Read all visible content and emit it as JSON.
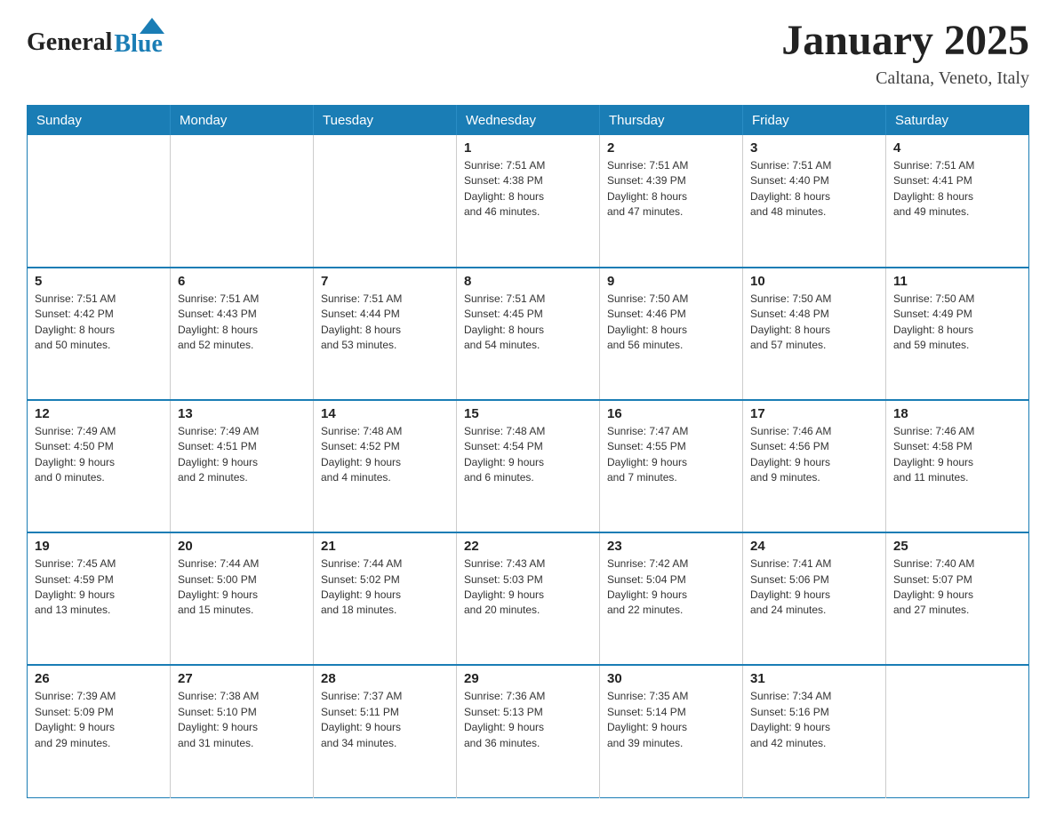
{
  "header": {
    "logo_general": "General",
    "logo_blue": "Blue",
    "month_title": "January 2025",
    "location": "Caltana, Veneto, Italy"
  },
  "weekdays": [
    "Sunday",
    "Monday",
    "Tuesday",
    "Wednesday",
    "Thursday",
    "Friday",
    "Saturday"
  ],
  "weeks": [
    [
      {
        "day": "",
        "info": ""
      },
      {
        "day": "",
        "info": ""
      },
      {
        "day": "",
        "info": ""
      },
      {
        "day": "1",
        "info": "Sunrise: 7:51 AM\nSunset: 4:38 PM\nDaylight: 8 hours\nand 46 minutes."
      },
      {
        "day": "2",
        "info": "Sunrise: 7:51 AM\nSunset: 4:39 PM\nDaylight: 8 hours\nand 47 minutes."
      },
      {
        "day": "3",
        "info": "Sunrise: 7:51 AM\nSunset: 4:40 PM\nDaylight: 8 hours\nand 48 minutes."
      },
      {
        "day": "4",
        "info": "Sunrise: 7:51 AM\nSunset: 4:41 PM\nDaylight: 8 hours\nand 49 minutes."
      }
    ],
    [
      {
        "day": "5",
        "info": "Sunrise: 7:51 AM\nSunset: 4:42 PM\nDaylight: 8 hours\nand 50 minutes."
      },
      {
        "day": "6",
        "info": "Sunrise: 7:51 AM\nSunset: 4:43 PM\nDaylight: 8 hours\nand 52 minutes."
      },
      {
        "day": "7",
        "info": "Sunrise: 7:51 AM\nSunset: 4:44 PM\nDaylight: 8 hours\nand 53 minutes."
      },
      {
        "day": "8",
        "info": "Sunrise: 7:51 AM\nSunset: 4:45 PM\nDaylight: 8 hours\nand 54 minutes."
      },
      {
        "day": "9",
        "info": "Sunrise: 7:50 AM\nSunset: 4:46 PM\nDaylight: 8 hours\nand 56 minutes."
      },
      {
        "day": "10",
        "info": "Sunrise: 7:50 AM\nSunset: 4:48 PM\nDaylight: 8 hours\nand 57 minutes."
      },
      {
        "day": "11",
        "info": "Sunrise: 7:50 AM\nSunset: 4:49 PM\nDaylight: 8 hours\nand 59 minutes."
      }
    ],
    [
      {
        "day": "12",
        "info": "Sunrise: 7:49 AM\nSunset: 4:50 PM\nDaylight: 9 hours\nand 0 minutes."
      },
      {
        "day": "13",
        "info": "Sunrise: 7:49 AM\nSunset: 4:51 PM\nDaylight: 9 hours\nand 2 minutes."
      },
      {
        "day": "14",
        "info": "Sunrise: 7:48 AM\nSunset: 4:52 PM\nDaylight: 9 hours\nand 4 minutes."
      },
      {
        "day": "15",
        "info": "Sunrise: 7:48 AM\nSunset: 4:54 PM\nDaylight: 9 hours\nand 6 minutes."
      },
      {
        "day": "16",
        "info": "Sunrise: 7:47 AM\nSunset: 4:55 PM\nDaylight: 9 hours\nand 7 minutes."
      },
      {
        "day": "17",
        "info": "Sunrise: 7:46 AM\nSunset: 4:56 PM\nDaylight: 9 hours\nand 9 minutes."
      },
      {
        "day": "18",
        "info": "Sunrise: 7:46 AM\nSunset: 4:58 PM\nDaylight: 9 hours\nand 11 minutes."
      }
    ],
    [
      {
        "day": "19",
        "info": "Sunrise: 7:45 AM\nSunset: 4:59 PM\nDaylight: 9 hours\nand 13 minutes."
      },
      {
        "day": "20",
        "info": "Sunrise: 7:44 AM\nSunset: 5:00 PM\nDaylight: 9 hours\nand 15 minutes."
      },
      {
        "day": "21",
        "info": "Sunrise: 7:44 AM\nSunset: 5:02 PM\nDaylight: 9 hours\nand 18 minutes."
      },
      {
        "day": "22",
        "info": "Sunrise: 7:43 AM\nSunset: 5:03 PM\nDaylight: 9 hours\nand 20 minutes."
      },
      {
        "day": "23",
        "info": "Sunrise: 7:42 AM\nSunset: 5:04 PM\nDaylight: 9 hours\nand 22 minutes."
      },
      {
        "day": "24",
        "info": "Sunrise: 7:41 AM\nSunset: 5:06 PM\nDaylight: 9 hours\nand 24 minutes."
      },
      {
        "day": "25",
        "info": "Sunrise: 7:40 AM\nSunset: 5:07 PM\nDaylight: 9 hours\nand 27 minutes."
      }
    ],
    [
      {
        "day": "26",
        "info": "Sunrise: 7:39 AM\nSunset: 5:09 PM\nDaylight: 9 hours\nand 29 minutes."
      },
      {
        "day": "27",
        "info": "Sunrise: 7:38 AM\nSunset: 5:10 PM\nDaylight: 9 hours\nand 31 minutes."
      },
      {
        "day": "28",
        "info": "Sunrise: 7:37 AM\nSunset: 5:11 PM\nDaylight: 9 hours\nand 34 minutes."
      },
      {
        "day": "29",
        "info": "Sunrise: 7:36 AM\nSunset: 5:13 PM\nDaylight: 9 hours\nand 36 minutes."
      },
      {
        "day": "30",
        "info": "Sunrise: 7:35 AM\nSunset: 5:14 PM\nDaylight: 9 hours\nand 39 minutes."
      },
      {
        "day": "31",
        "info": "Sunrise: 7:34 AM\nSunset: 5:16 PM\nDaylight: 9 hours\nand 42 minutes."
      },
      {
        "day": "",
        "info": ""
      }
    ]
  ]
}
